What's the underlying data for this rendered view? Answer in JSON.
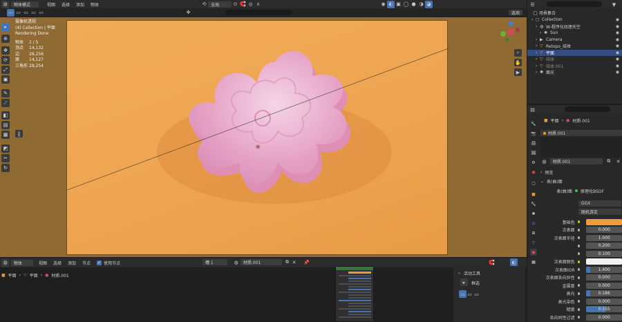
{
  "top_header": {
    "mode": "物体模式",
    "menus": [
      "视图",
      "选择",
      "添加",
      "物体"
    ],
    "orientation": "全局",
    "options_label": "选项"
  },
  "viewport_overlay": {
    "camera_view": "摄像机透视",
    "collection_path": "(4) Collection | 平面",
    "status": "Rendering Done",
    "stats": [
      {
        "label": "物体",
        "value": "1 / 5"
      },
      {
        "label": "顶点",
        "value": "14,132"
      },
      {
        "label": "边",
        "value": "28,256"
      },
      {
        "label": "面",
        "value": "14,127"
      },
      {
        "label": "三角形",
        "value": "28,254"
      }
    ]
  },
  "outliner": {
    "title": "场景集合",
    "rows": [
      {
        "label": "Collection",
        "indent": 1,
        "icon": "collection-icon",
        "color": "#d0d0d0",
        "selected": false
      },
      {
        "label": "W-程序化纹理天空",
        "indent": 2,
        "icon": "world-icon",
        "color": "#d0d0d0",
        "selected": false
      },
      {
        "label": "Sun",
        "indent": 3,
        "icon": "light-icon",
        "color": "#d0d0d0",
        "selected": false
      },
      {
        "label": "Camera",
        "indent": 2,
        "icon": "camera-icon",
        "color": "#d0d0d0",
        "selected": false
      },
      {
        "label": "Retopo_结体",
        "indent": 2,
        "icon": "mesh-icon",
        "color": "#d0d0d0",
        "selected": false
      },
      {
        "label": "平面",
        "indent": 2,
        "icon": "mesh-icon",
        "color": "#ffffff",
        "selected": true
      },
      {
        "label": "结体",
        "indent": 2,
        "icon": "mesh-icon",
        "color": "#8a8a8a",
        "selected": false
      },
      {
        "label": "结体.001",
        "indent": 2,
        "icon": "mesh-icon",
        "color": "#8a8a8a",
        "selected": false
      },
      {
        "label": "面光",
        "indent": 2,
        "icon": "light-icon",
        "color": "#d0d0d0",
        "selected": false
      }
    ]
  },
  "properties": {
    "breadcrumb_object": "平面",
    "breadcrumb_material": "材质.001",
    "slot_name": "材质.001",
    "material_name": "材质.001",
    "preview_label": "预览",
    "surface_label": "表(曲)面",
    "surface_row_label": "表(曲)面",
    "surface_shader": "原理化BSDF",
    "distribution": "GGX",
    "subsurface_method": "随机游走",
    "rows": [
      {
        "label": "基础色",
        "value": "",
        "kind": "color-orange"
      },
      {
        "label": "次表面",
        "value": "0.000",
        "kind": "number"
      },
      {
        "label": "次表面半径",
        "value": "1.000",
        "kind": "number"
      },
      {
        "label": "",
        "value": "0.200",
        "kind": "number"
      },
      {
        "label": "",
        "value": "0.100",
        "kind": "number"
      },
      {
        "label": "次表面颜色",
        "value": "",
        "kind": "color-white"
      },
      {
        "label": "次表面IOR",
        "value": "1.400",
        "kind": "slider"
      },
      {
        "label": "次表面各向异性",
        "value": "0.000",
        "kind": "number"
      },
      {
        "label": "金属度",
        "value": "0.000",
        "kind": "number"
      },
      {
        "label": "高光",
        "value": "0.186",
        "kind": "slider"
      },
      {
        "label": "高光染色",
        "value": "0.000",
        "kind": "number"
      },
      {
        "label": "糙度",
        "value": "0.555",
        "kind": "slider-blue"
      },
      {
        "label": "各向同性过滤",
        "value": "0.000",
        "kind": "number"
      }
    ]
  },
  "node_editor": {
    "mode": "物体",
    "menus": [
      "视图",
      "选择",
      "添加",
      "节点"
    ],
    "use_nodes_label": "使用节点",
    "slot": "槽 1",
    "material": "材质.001",
    "breadcrumb_object": "平面",
    "breadcrumb_mesh": "平面",
    "breadcrumb_material": "材质.001",
    "active_tool_title": "活动工具",
    "active_tool_name": "框选"
  },
  "colors": {
    "selection": "#334d80",
    "accent_blue": "#4772b3",
    "base_color_swatch": "#f39a3c",
    "render_background": "#eea552",
    "flower_pink": "#e9a6c6"
  }
}
